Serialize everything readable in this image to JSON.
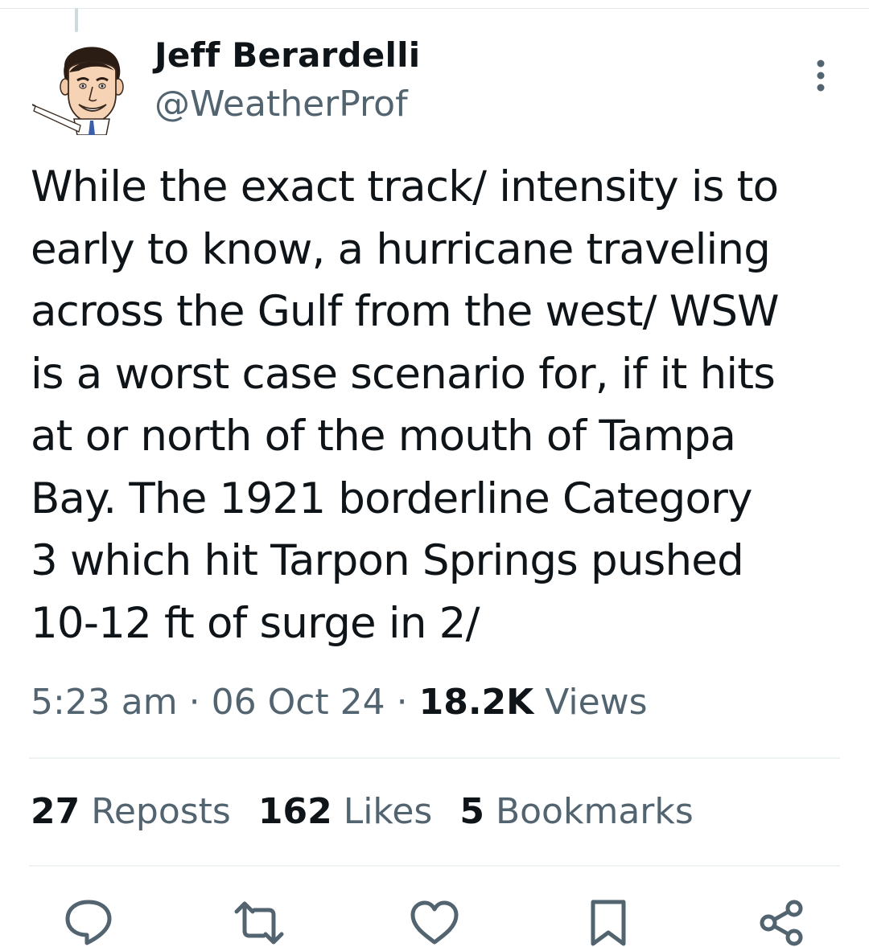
{
  "author": {
    "name": "Jeff Berardelli",
    "handle": "@WeatherProf",
    "avatar_icon": "caricature-avatar"
  },
  "tweet": {
    "text": "While the exact track/ intensity is to\nearly to know, a hurricane traveling\nacross the Gulf from the west/ WSW\nis a worst case scenario for, if it hits\nat or north of the mouth of Tampa\nBay. The 1921 borderline Category\n3 which hit Tarpon Springs pushed\n10-12 ft of surge in 2/"
  },
  "meta": {
    "time": "5:23 am",
    "sep1": " · ",
    "date": "06 Oct 24",
    "sep2": " · ",
    "views_count": "18.2K",
    "views_label": " Views"
  },
  "stats": {
    "reposts_count": "27",
    "reposts_label": " Reposts",
    "likes_count": "162",
    "likes_label": " Likes",
    "bookmarks_count": "5",
    "bookmarks_label": " Bookmarks"
  },
  "actions": [
    {
      "icon": "reply-icon"
    },
    {
      "icon": "repost-icon"
    },
    {
      "icon": "like-icon"
    },
    {
      "icon": "bookmark-icon"
    },
    {
      "icon": "share-icon"
    }
  ],
  "colors": {
    "text_primary": "#0f1419",
    "text_secondary": "#536471",
    "divider": "#eff3f4",
    "icon": "#536471"
  }
}
